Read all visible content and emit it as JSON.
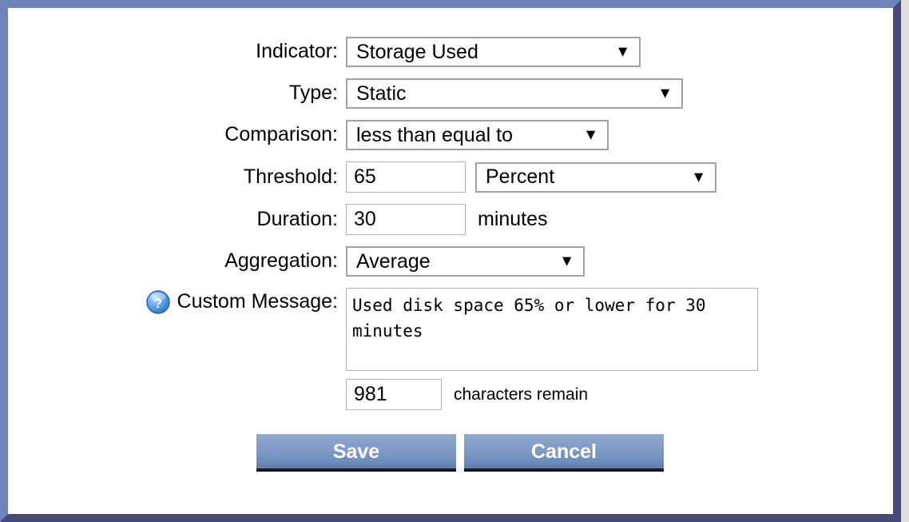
{
  "theme": {
    "frame_light": "#6d85ba",
    "frame_dark": "#464a79",
    "button_top": "#93aacf",
    "button_bottom": "#5e7cac",
    "page_background": "#dcdcdc"
  },
  "form": {
    "indicator": {
      "label": "Indicator:",
      "value": "Storage Used",
      "arrow": "▼"
    },
    "type": {
      "label": "Type:",
      "value": "Static",
      "arrow": "▼"
    },
    "comparison": {
      "label": "Comparison:",
      "value": "less than equal to",
      "arrow": "▼"
    },
    "threshold": {
      "label": "Threshold:",
      "value": "65",
      "unit_value": "Percent",
      "arrow": "▼"
    },
    "duration": {
      "label": "Duration:",
      "value": "30",
      "suffix": "minutes"
    },
    "aggregation": {
      "label": "Aggregation:",
      "value": "Average",
      "arrow": "▼"
    },
    "custom_message": {
      "label": "Custom Message:",
      "help_icon": "help-circle-icon",
      "value": "Used disk space 65% or lower for 30 minutes"
    },
    "characters_remain": {
      "value": "981",
      "suffix": "characters remain"
    }
  },
  "buttons": {
    "save": "Save",
    "cancel": "Cancel"
  }
}
